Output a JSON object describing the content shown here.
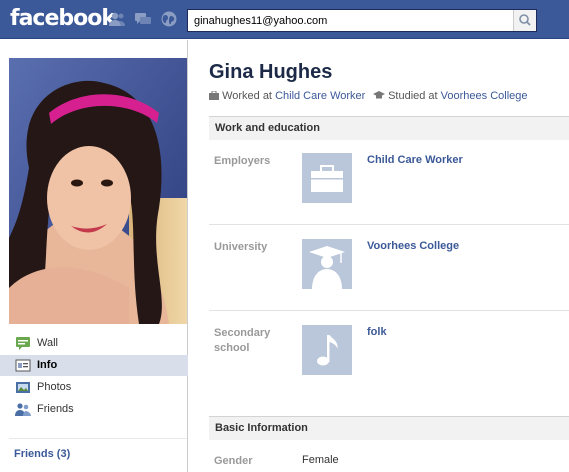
{
  "topbar": {
    "logo": "facebook",
    "search_value": "ginahughes11@yahoo.com"
  },
  "nav": {
    "items": [
      {
        "label": "Wall"
      },
      {
        "label": "Info"
      },
      {
        "label": "Photos"
      },
      {
        "label": "Friends"
      }
    ],
    "friends_header": "Friends (3)"
  },
  "profile": {
    "name": "Gina Hughes",
    "worked_prefix": "Worked at",
    "worked_at": "Child Care Worker",
    "studied_prefix": "Studied at",
    "studied_at": "Voorhees College"
  },
  "work_education": {
    "header": "Work and education",
    "rows": [
      {
        "label": "Employers",
        "value": "Child Care Worker"
      },
      {
        "label": "University",
        "value": "Voorhees College"
      },
      {
        "label": "Secondary school",
        "value": "folk"
      }
    ]
  },
  "basic": {
    "header": "Basic Information",
    "gender_label": "Gender",
    "gender_value": "Female"
  },
  "colors": {
    "brand": "#3b5998",
    "nav_active": "#d8dfea"
  }
}
